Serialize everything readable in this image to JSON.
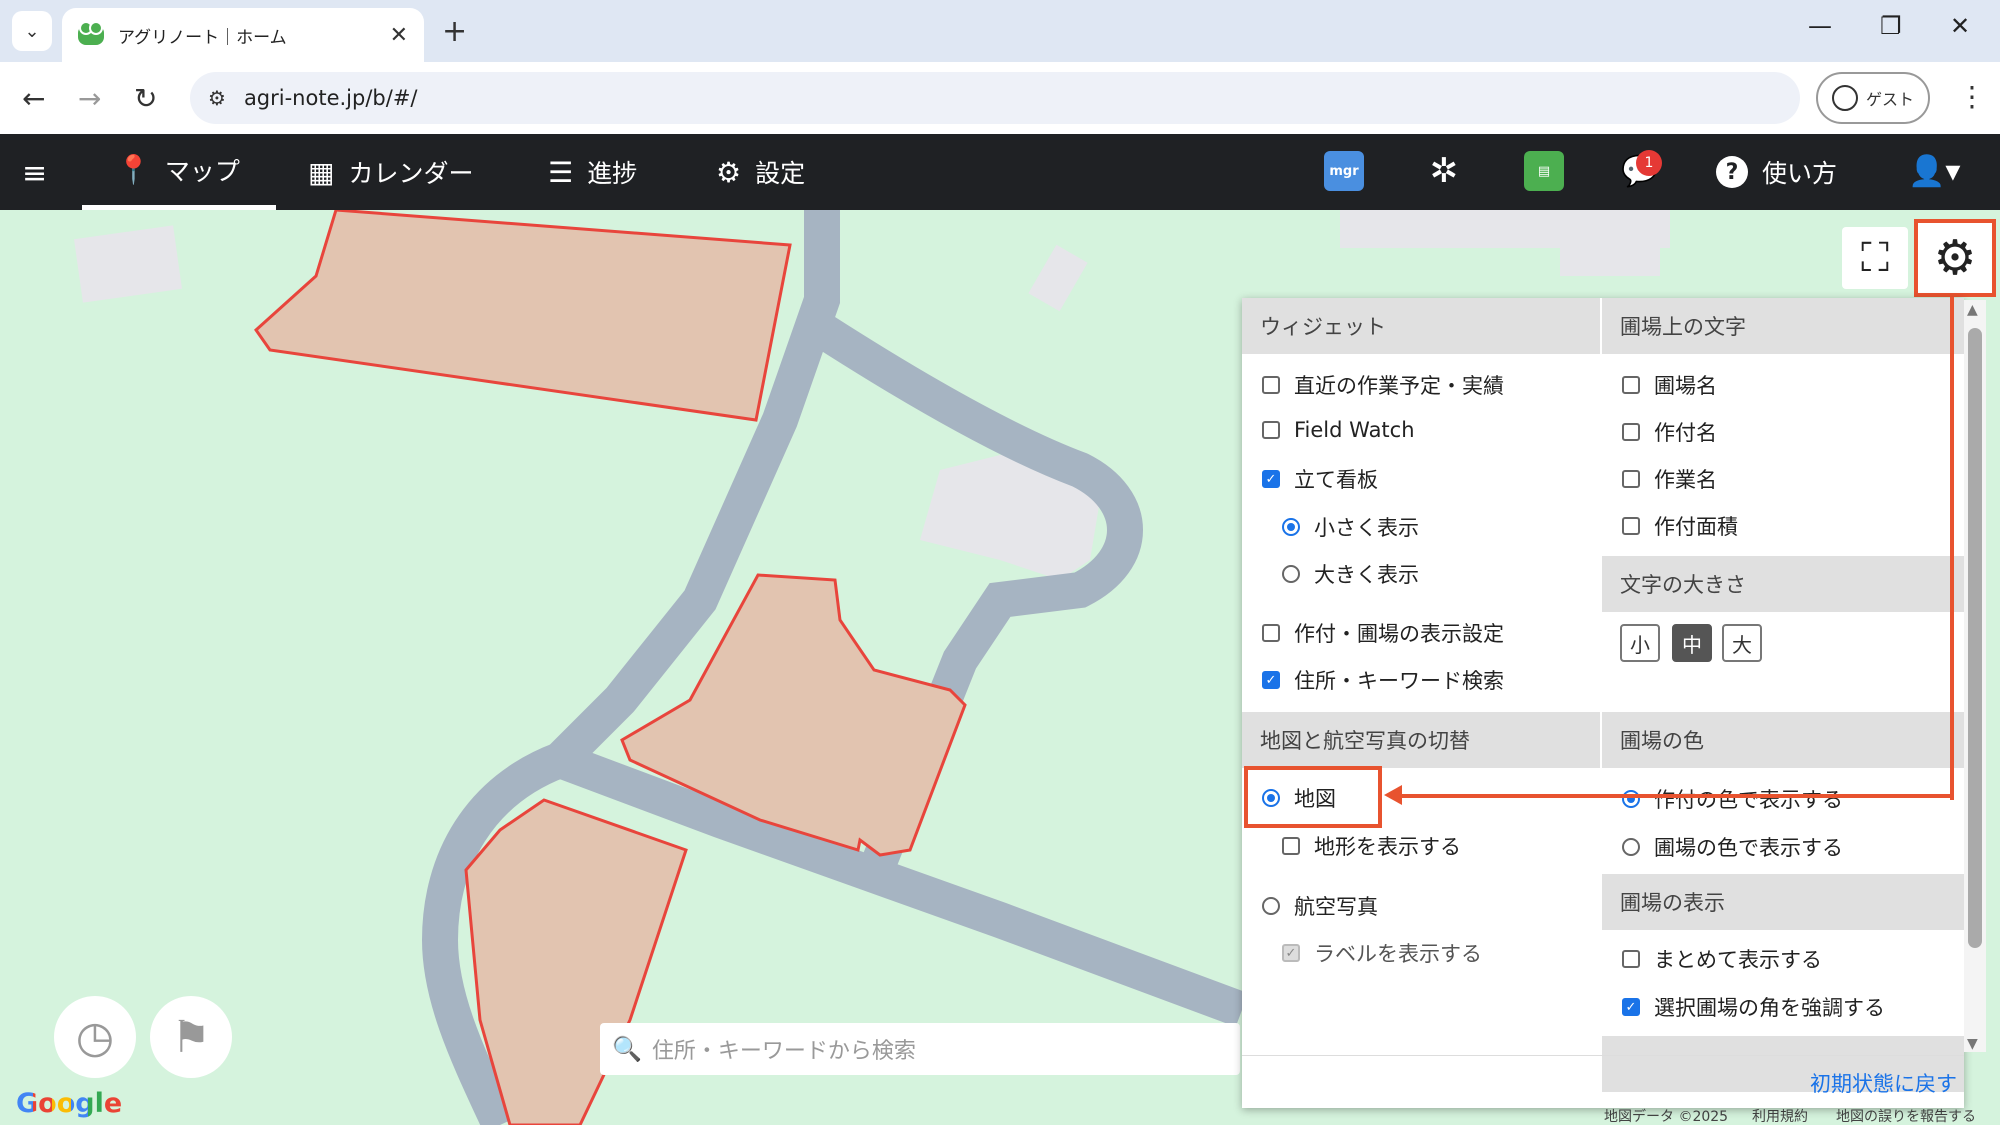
{
  "browser": {
    "tab_title": "アグリノート｜ホーム",
    "url": "agri-note.jp/b/#/",
    "guest_label": "ゲスト"
  },
  "header": {
    "menu": [
      {
        "label": "マップ"
      },
      {
        "label": "カレンダー"
      },
      {
        "label": "進捗"
      },
      {
        "label": "設定"
      }
    ],
    "mgr_label": "mgr",
    "notification_count": "1",
    "help_label": "使い方"
  },
  "map": {
    "search_placeholder": "住所・キーワードから検索",
    "google_logo": "Google",
    "footer": [
      "地図データ ©2025",
      "利用規約",
      "地図の誤りを報告する"
    ]
  },
  "settings_panel": {
    "widget_header": "ウィジェット",
    "widget_options": [
      {
        "label": "直近の作業予定・実績",
        "checked": false
      },
      {
        "label": "Field Watch",
        "checked": false
      },
      {
        "label": "立て看板",
        "checked": true
      }
    ],
    "signboard_size": [
      {
        "label": "小さく表示",
        "selected": true
      },
      {
        "label": "大きく表示",
        "selected": false
      }
    ],
    "widget_options_2": [
      {
        "label": "作付・圃場の表示設定",
        "checked": false
      },
      {
        "label": "住所・キーワード検索",
        "checked": true
      }
    ],
    "field_text_header": "圃場上の文字",
    "field_text_options": [
      {
        "label": "圃場名",
        "checked": false
      },
      {
        "label": "作付名",
        "checked": false
      },
      {
        "label": "作業名",
        "checked": false
      },
      {
        "label": "作付面積",
        "checked": false
      }
    ],
    "text_size_header": "文字の大きさ",
    "text_sizes": [
      {
        "label": "小",
        "selected": false
      },
      {
        "label": "中",
        "selected": true
      },
      {
        "label": "大",
        "selected": false
      }
    ],
    "map_switch_header": "地図と航空写真の切替",
    "map_option": {
      "label": "地図",
      "selected": true
    },
    "terrain_option": {
      "label": "地形を表示する",
      "checked": false
    },
    "aerial_option": {
      "label": "航空写真",
      "selected": false
    },
    "labels_option": {
      "label": "ラベルを表示する",
      "checked": true,
      "disabled": true
    },
    "field_color_header": "圃場の色",
    "field_color_options": [
      {
        "label": "作付の色で表示する",
        "selected": true
      },
      {
        "label": "圃場の色で表示する",
        "selected": false
      }
    ],
    "field_display_header": "圃場の表示",
    "field_display_options": [
      {
        "label": "まとめて表示する",
        "checked": false
      },
      {
        "label": "選択圃場の角を強調する",
        "checked": true
      }
    ],
    "reset_label": "初期状態に戻す"
  },
  "colors": {
    "accent": "#1a73e8",
    "highlight": "#e8532f",
    "header_bg": "#1f2124",
    "map_bg": "#d5f3dd",
    "road": "#a6b4c2",
    "field_fill": "#e2c4b0",
    "field_stroke": "#e8453c"
  }
}
